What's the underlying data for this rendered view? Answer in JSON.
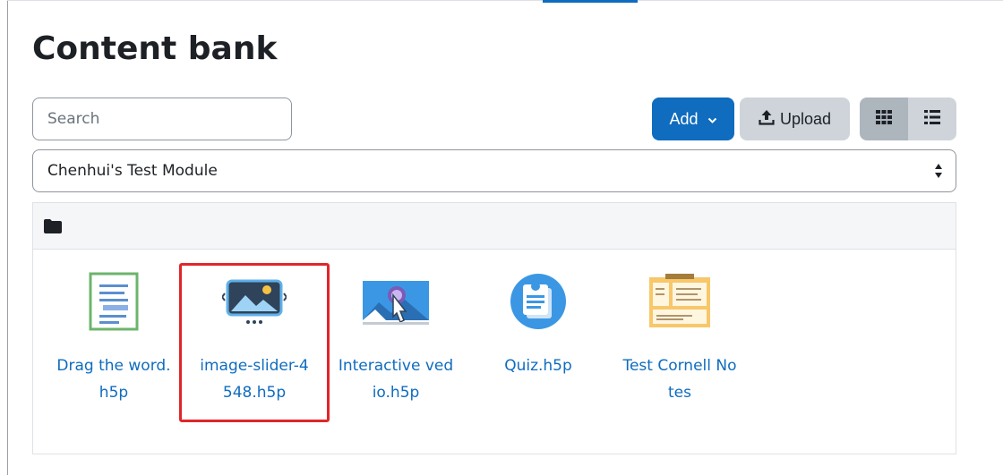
{
  "page": {
    "title": "Content bank"
  },
  "toolbar": {
    "search_placeholder": "Search",
    "add_label": "Add",
    "upload_label": "Upload"
  },
  "context_select": {
    "value": "Chenhui's Test Module"
  },
  "items": [
    {
      "name": "Drag the word.h5p",
      "icon": "drag-words-icon"
    },
    {
      "name": "image-slider-4548.h5p",
      "icon": "image-slider-icon",
      "highlighted": true
    },
    {
      "name": "Interactive vedio.h5p",
      "icon": "interactive-video-icon"
    },
    {
      "name": "Quiz.h5p",
      "icon": "quiz-icon"
    },
    {
      "name": "Test Cornell Notes",
      "icon": "cornell-notes-icon"
    }
  ],
  "colors": {
    "primary": "#0f6cbf",
    "highlight": "#e0262a",
    "secondary_button": "#ced4da"
  }
}
